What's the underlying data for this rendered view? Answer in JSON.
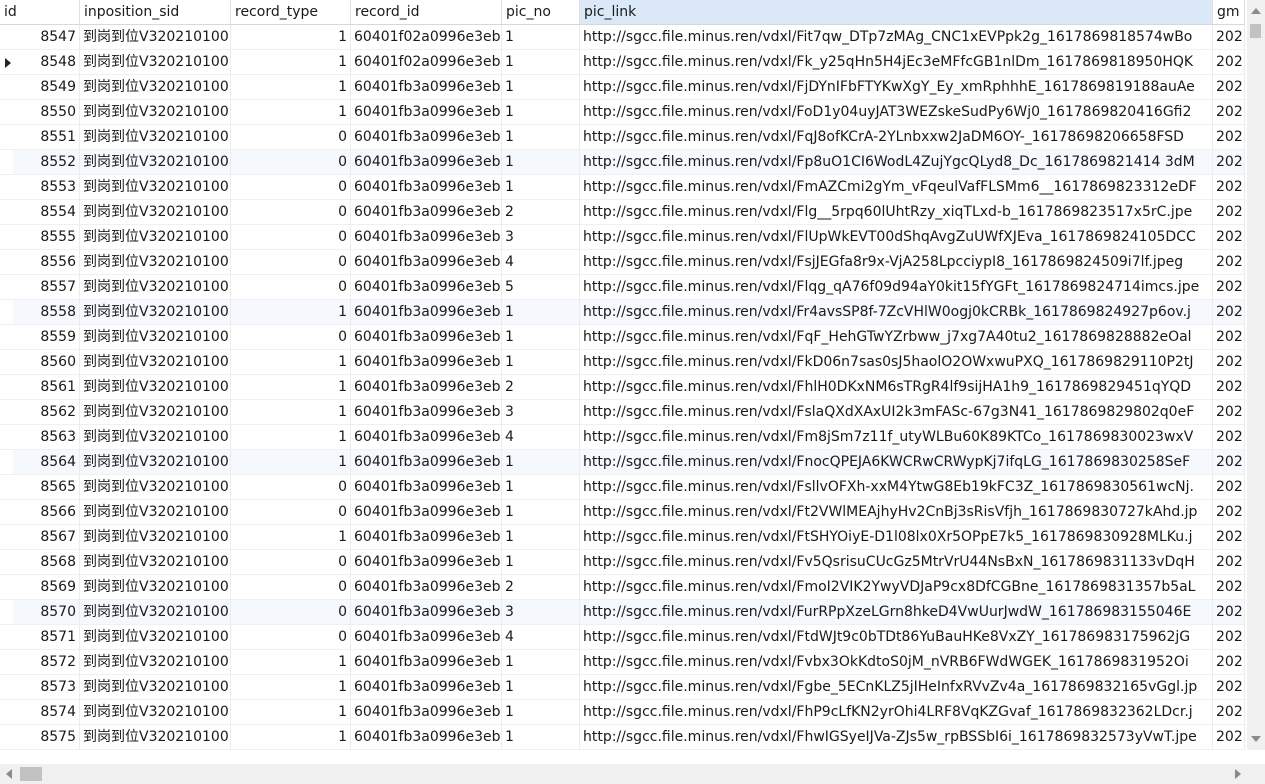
{
  "columns": [
    "id",
    "inposition_sid",
    "record_type",
    "record_id",
    "pic_no",
    "pic_link",
    "gm"
  ],
  "current_row_index": 1,
  "rows": [
    {
      "id": "8547",
      "sid": "到岗到位V320210100",
      "type": "1",
      "rid": "60401f02a0996e3eb",
      "pno": "1",
      "link": "http://sgcc.file.minus.ren/vdxl/Fit7qw_DTp7zMAg_CNC1xEVPpk2g_1617869818574wBo",
      "gm": "202"
    },
    {
      "id": "8548",
      "sid": "到岗到位V320210100",
      "type": "1",
      "rid": "60401f02a0996e3eb",
      "pno": "1",
      "link": "http://sgcc.file.minus.ren/vdxl/Fk_y25qHn5H4jEc3eMFfcGB1nlDm_1617869818950HQK",
      "gm": "202"
    },
    {
      "id": "8549",
      "sid": "到岗到位V320210100",
      "type": "1",
      "rid": "60401fb3a0996e3eb",
      "pno": "1",
      "link": "http://sgcc.file.minus.ren/vdxl/FjDYnIFbFTYKwXgY_Ey_xmRphhhE_1617869819188auAe",
      "gm": "202"
    },
    {
      "id": "8550",
      "sid": "到岗到位V320210100",
      "type": "1",
      "rid": "60401fb3a0996e3eb",
      "pno": "1",
      "link": "http://sgcc.file.minus.ren/vdxl/FoD1y04uyJAT3WEZskeSudPy6Wj0_1617869820416Gfi2",
      "gm": "202"
    },
    {
      "id": "8551",
      "sid": "到岗到位V320210100",
      "type": "0",
      "rid": "60401fb3a0996e3eb",
      "pno": "1",
      "link": "http://sgcc.file.minus.ren/vdxl/FqJ8ofKCrA-2YLnbxxw2JaDM6OY-_16178698206658FSD",
      "gm": "202"
    },
    {
      "id": "8552",
      "sid": "到岗到位V320210100",
      "type": "0",
      "rid": "60401fb3a0996e3eb",
      "pno": "1",
      "link": "http://sgcc.file.minus.ren/vdxl/Fp8uO1CI6WodL4ZujYgcQLyd8_Dc_1617869821414 3dM",
      "gm": "202"
    },
    {
      "id": "8553",
      "sid": "到岗到位V320210100",
      "type": "0",
      "rid": "60401fb3a0996e3eb",
      "pno": "1",
      "link": "http://sgcc.file.minus.ren/vdxl/FmAZCmi2gYm_vFqeulVafFLSMm6__1617869823312eDF",
      "gm": "202"
    },
    {
      "id": "8554",
      "sid": "到岗到位V320210100",
      "type": "0",
      "rid": "60401fb3a0996e3eb",
      "pno": "2",
      "link": "http://sgcc.file.minus.ren/vdxl/Flg__5rpq60lUhtRzy_xiqTLxd-b_1617869823517x5rC.jpe",
      "gm": "202"
    },
    {
      "id": "8555",
      "sid": "到岗到位V320210100",
      "type": "0",
      "rid": "60401fb3a0996e3eb",
      "pno": "3",
      "link": "http://sgcc.file.minus.ren/vdxl/FlUpWkEVT00dShqAvgZuUWfXJEva_1617869824105DCC",
      "gm": "202"
    },
    {
      "id": "8556",
      "sid": "到岗到位V320210100",
      "type": "0",
      "rid": "60401fb3a0996e3eb",
      "pno": "4",
      "link": "http://sgcc.file.minus.ren/vdxl/FsjJEGfa8r9x-VjA258LpcciypI8_1617869824509i7lf.jpeg",
      "gm": "202"
    },
    {
      "id": "8557",
      "sid": "到岗到位V320210100",
      "type": "0",
      "rid": "60401fb3a0996e3eb",
      "pno": "5",
      "link": "http://sgcc.file.minus.ren/vdxl/Flqg_qA76f09d94aY0kit15fYGFt_1617869824714imcs.jpe",
      "gm": "202"
    },
    {
      "id": "8558",
      "sid": "到岗到位V320210100",
      "type": "1",
      "rid": "60401fb3a0996e3eb",
      "pno": "1",
      "link": "http://sgcc.file.minus.ren/vdxl/Fr4avsSP8f-7ZcVHlW0ogj0kCRBk_1617869824927p6ov.j",
      "gm": "202"
    },
    {
      "id": "8559",
      "sid": "到岗到位V320210100",
      "type": "0",
      "rid": "60401fb3a0996e3eb",
      "pno": "1",
      "link": "http://sgcc.file.minus.ren/vdxl/FqF_HehGTwYZrbww_j7xg7A40tu2_1617869828882eOal",
      "gm": "202"
    },
    {
      "id": "8560",
      "sid": "到岗到位V320210100",
      "type": "1",
      "rid": "60401fb3a0996e3eb",
      "pno": "1",
      "link": "http://sgcc.file.minus.ren/vdxl/FkD06n7sas0sJ5haolO2OWxwuPXQ_1617869829110P2tJ",
      "gm": "202"
    },
    {
      "id": "8561",
      "sid": "到岗到位V320210100",
      "type": "1",
      "rid": "60401fb3a0996e3eb",
      "pno": "2",
      "link": "http://sgcc.file.minus.ren/vdxl/FhlH0DKxNM6sTRgR4lf9sijHA1h9_1617869829451qYQD",
      "gm": "202"
    },
    {
      "id": "8562",
      "sid": "到岗到位V320210100",
      "type": "1",
      "rid": "60401fb3a0996e3eb",
      "pno": "3",
      "link": "http://sgcc.file.minus.ren/vdxl/FslaQXdXAxUI2k3mFASc-67g3N41_1617869829802q0eF",
      "gm": "202"
    },
    {
      "id": "8563",
      "sid": "到岗到位V320210100",
      "type": "1",
      "rid": "60401fb3a0996e3eb",
      "pno": "4",
      "link": "http://sgcc.file.minus.ren/vdxl/Fm8jSm7z11f_utyWLBu60K89KTCo_1617869830023wxV",
      "gm": "202"
    },
    {
      "id": "8564",
      "sid": "到岗到位V320210100",
      "type": "1",
      "rid": "60401fb3a0996e3eb",
      "pno": "1",
      "link": "http://sgcc.file.minus.ren/vdxl/FnocQPEJA6KWCRwCRWypKj7ifqLG_1617869830258SeF",
      "gm": "202"
    },
    {
      "id": "8565",
      "sid": "到岗到位V320210100",
      "type": "0",
      "rid": "60401fb3a0996e3eb",
      "pno": "1",
      "link": "http://sgcc.file.minus.ren/vdxl/FsllvOFXh-xxM4YtwG8Eb19kFC3Z_1617869830561wcNj.",
      "gm": "202"
    },
    {
      "id": "8566",
      "sid": "到岗到位V320210100",
      "type": "0",
      "rid": "60401fb3a0996e3eb",
      "pno": "1",
      "link": "http://sgcc.file.minus.ren/vdxl/Ft2VWlMEAjhyHv2CnBj3sRisVfjh_1617869830727kAhd.jp",
      "gm": "202"
    },
    {
      "id": "8567",
      "sid": "到岗到位V320210100",
      "type": "1",
      "rid": "60401fb3a0996e3eb",
      "pno": "1",
      "link": "http://sgcc.file.minus.ren/vdxl/FtSHYOiyE-D1l08lx0Xr5OPpE7k5_1617869830928MLKu.j",
      "gm": "202"
    },
    {
      "id": "8568",
      "sid": "到岗到位V320210100",
      "type": "0",
      "rid": "60401fb3a0996e3eb",
      "pno": "1",
      "link": "http://sgcc.file.minus.ren/vdxl/Fv5QsrisuCUcGz5MtrVrU44NsBxN_1617869831133vDqH",
      "gm": "202"
    },
    {
      "id": "8569",
      "sid": "到岗到位V320210100",
      "type": "0",
      "rid": "60401fb3a0996e3eb",
      "pno": "2",
      "link": "http://sgcc.file.minus.ren/vdxl/FmoI2VIK2YwyVDJaP9cx8DfCGBne_1617869831357b5aL",
      "gm": "202"
    },
    {
      "id": "8570",
      "sid": "到岗到位V320210100",
      "type": "0",
      "rid": "60401fb3a0996e3eb",
      "pno": "3",
      "link": "http://sgcc.file.minus.ren/vdxl/FurRPpXzeLGrn8hkeD4VwUurJwdW_161786983155046E",
      "gm": "202"
    },
    {
      "id": "8571",
      "sid": "到岗到位V320210100",
      "type": "0",
      "rid": "60401fb3a0996e3eb",
      "pno": "4",
      "link": "http://sgcc.file.minus.ren/vdxl/FtdWJt9c0bTDt86YuBauHKe8VxZY_161786983175962jG",
      "gm": "202"
    },
    {
      "id": "8572",
      "sid": "到岗到位V320210100",
      "type": "1",
      "rid": "60401fb3a0996e3eb",
      "pno": "1",
      "link": "http://sgcc.file.minus.ren/vdxl/Fvbx3OkKdtoS0jM_nVRB6FWdWGEK_1617869831952Oi",
      "gm": "202"
    },
    {
      "id": "8573",
      "sid": "到岗到位V320210100",
      "type": "1",
      "rid": "60401fb3a0996e3eb",
      "pno": "1",
      "link": "http://sgcc.file.minus.ren/vdxl/Fgbe_5ECnKLZ5jIHeInfxRVvZv4a_1617869832165vGgl.jp",
      "gm": "202"
    },
    {
      "id": "8574",
      "sid": "到岗到位V320210100",
      "type": "1",
      "rid": "60401fb3a0996e3eb",
      "pno": "1",
      "link": "http://sgcc.file.minus.ren/vdxl/FhP9cLfKN2yrOhi4LRF8VqKZGvaf_1617869832362LDcr.j",
      "gm": "202"
    },
    {
      "id": "8575",
      "sid": "到岗到位V320210100",
      "type": "1",
      "rid": "60401fb3a0996e3eb",
      "pno": "1",
      "link": "http://sgcc.file.minus.ren/vdxl/FhwIGSyeIJVa-ZJs5w_rpBSSbI6i_1617869832573yVwT.jpe",
      "gm": "202"
    }
  ],
  "alt_row_ids": [
    "8552",
    "8558",
    "8564",
    "8570"
  ],
  "colors": {
    "header_selected": "#dae8f7",
    "alt_row": "#f5f8fd"
  },
  "icons": {
    "row_marker": "row-pointer-icon"
  }
}
